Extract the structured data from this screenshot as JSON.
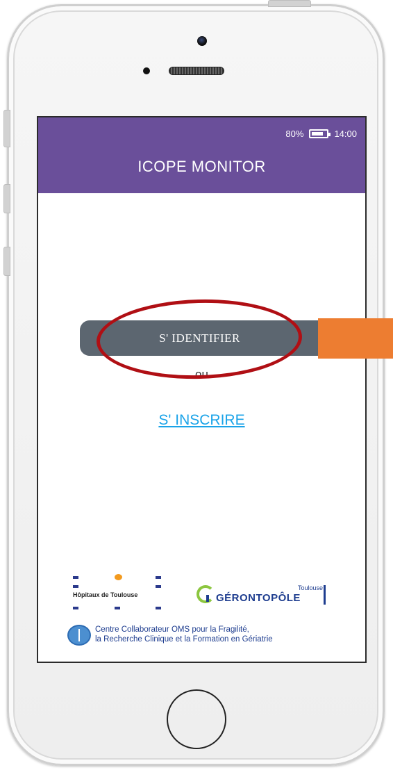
{
  "status_bar": {
    "battery": "80%",
    "time": "14:00"
  },
  "app": {
    "title": "ICOPE MONITOR"
  },
  "login": {
    "button_label": "S' IDENTIFIER",
    "or_text": "ou",
    "register_label": "S' INSCRIRE"
  },
  "footer": {
    "hospital_logo_text": "Hôpitaux de Toulouse",
    "gerontopole_name": "GÉRONTOPÔLE",
    "gerontopole_city": "Toulouse",
    "who_line1": "Centre Collaborateur OMS pour la Fragilité,",
    "who_line2": "la Recherche Clinique et la Formation en Gériatrie"
  },
  "colors": {
    "appbar": "#6a4f9a",
    "login_button": "#5c6670",
    "link": "#1aa3e8",
    "annotation_ellipse": "#b00f14",
    "annotation_box": "#ed7d31"
  }
}
